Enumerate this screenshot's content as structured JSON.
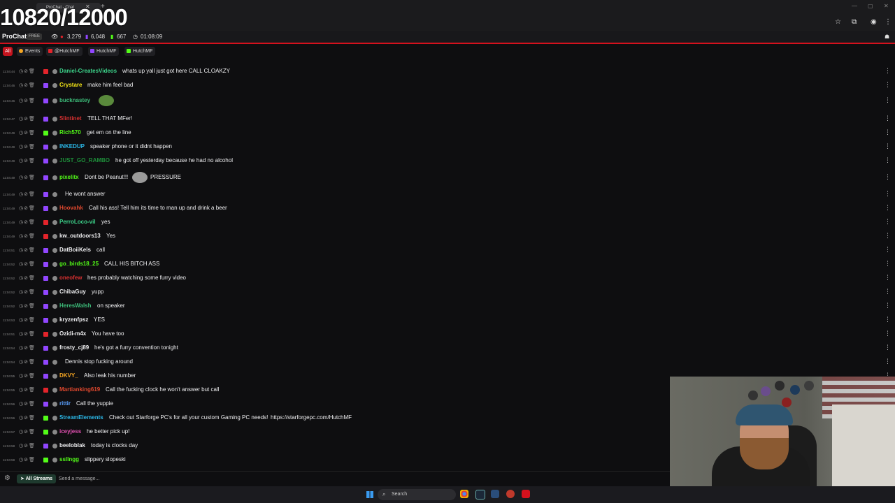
{
  "overlay": {
    "counter": "10820/12000"
  },
  "browser": {
    "tab_title": "ProChat - Chat"
  },
  "stats": {
    "brand": "ProChat",
    "plan": "FREE",
    "viewers": "3,279",
    "chatters": "6,048",
    "followers": "667",
    "uptime": "01:08:09"
  },
  "filters": [
    {
      "label": "All"
    },
    {
      "label": "Events"
    },
    {
      "label": "@HutchMF"
    },
    {
      "label": "HutchMF"
    },
    {
      "label": "HutchMF"
    }
  ],
  "colors": {
    "accent_red": "#d4111d",
    "youtube": "#e3242b",
    "twitch": "#9146ff",
    "kick": "#53fc18"
  },
  "messages": [
    {
      "time": "11:04:44",
      "platform": "youtube",
      "user": "Daniel-CreatesVideos",
      "color": "#3dd68c",
      "text": "whats up yall just got here CALL CLOAKZY"
    },
    {
      "time": "11:04:46",
      "platform": "twitch",
      "user": "Crystare",
      "color": "#f5e616",
      "text": "make him feel bad"
    },
    {
      "time": "11:04:46",
      "platform": "twitch",
      "user": "bucknastey",
      "color": "#3dbd7a",
      "text": ""
    },
    {
      "time": "11:04:47",
      "platform": "twitch",
      "user": "Slintinet",
      "color": "#d63030",
      "text": "TELL THAT MFer!"
    },
    {
      "time": "11:04:49",
      "platform": "kick",
      "user": "Rich570",
      "color": "#53fc18",
      "text": "get em on the line"
    },
    {
      "time": "11:04:49",
      "platform": "twitch",
      "user": "INKEDUP",
      "color": "#2bb8e8",
      "text": "speaker phone or it didnt happen"
    },
    {
      "time": "11:04:49",
      "platform": "twitch",
      "user": "JUST_GO_RAMBO",
      "color": "#1e8f3a",
      "text": "he got off yesterday because he had no alcohol"
    },
    {
      "time": "11:04:49",
      "platform": "twitch",
      "user": "pixelitx",
      "color": "#53fc18",
      "text": "Dont be Peanut!!!",
      "after": "PRESSURE"
    },
    {
      "time": "11:04:49",
      "platform": "twitch",
      "user": "",
      "color": "#1f3fcf",
      "text": "He wont answer"
    },
    {
      "time": "11:04:49",
      "platform": "twitch",
      "user": "Hoovahk",
      "color": "#e0482e",
      "text": "Call his ass! Tell him its time to man up and drink a beer"
    },
    {
      "time": "11:04:49",
      "platform": "youtube",
      "user": "PerroLoco-vil",
      "color": "#3dd68c",
      "text": "yes"
    },
    {
      "time": "11:04:49",
      "platform": "youtube",
      "user": "kw_outdoors13",
      "color": "#efeff1",
      "text": "Yes"
    },
    {
      "time": "11:04:51",
      "platform": "twitch",
      "user": "DatBoiiKels",
      "color": "#efeff1",
      "text": "call"
    },
    {
      "time": "11:04:52",
      "platform": "twitch",
      "user": "go_birds18_25",
      "color": "#53fc18",
      "text": "CALL HIS BITCH ASS"
    },
    {
      "time": "11:04:52",
      "platform": "twitch",
      "user": "oneofew",
      "color": "#d63030",
      "text": "hes probably watching some furry video"
    },
    {
      "time": "11:04:52",
      "platform": "twitch",
      "user": "ChibaGuy",
      "color": "#efeff1",
      "text": "yupp"
    },
    {
      "time": "11:04:52",
      "platform": "twitch",
      "user": "HeresWalsh",
      "color": "#3dbd7a",
      "text": "on speaker"
    },
    {
      "time": "11:04:53",
      "platform": "twitch",
      "user": "kryzenfpsz",
      "color": "#efeff1",
      "text": "YES"
    },
    {
      "time": "11:04:51",
      "platform": "youtube",
      "user": "Ozidi-m4x",
      "color": "#efeff1",
      "text": "You have too"
    },
    {
      "time": "11:04:54",
      "platform": "twitch",
      "user": "frosty_cj89",
      "color": "#efeff1",
      "text": "he's got a furry convention tonight"
    },
    {
      "time": "11:04:54",
      "platform": "twitch",
      "user": "",
      "color": "#1f3fcf",
      "text": "Dennis stop fucking around"
    },
    {
      "time": "11:04:55",
      "platform": "twitch",
      "user": "DKVY_",
      "color": "#f5a623",
      "text": "Also leak his number"
    },
    {
      "time": "11:04:55",
      "platform": "youtube",
      "user": "Martianking619",
      "color": "#e0482e",
      "text": "Call the fucking clock he won't answer but call"
    },
    {
      "time": "11:04:56",
      "platform": "twitch",
      "user": "rittir",
      "color": "#5aa0ff",
      "text": "Call the yuppie"
    },
    {
      "time": "11:04:56",
      "platform": "kick",
      "user": "StreamElements",
      "color": "#2bb8e8",
      "text": "Check out Starforge PC's for all your custom Gaming PC needs!",
      "link": "https://starforgepc.com/HutchMF"
    },
    {
      "time": "11:04:57",
      "platform": "kick",
      "user": "iceyjess",
      "color": "#e04fb0",
      "text": "he better pick up!"
    },
    {
      "time": "11:04:58",
      "platform": "twitch",
      "user": "beeloblak",
      "color": "#efeff1",
      "text": "today is clocks day"
    },
    {
      "time": "11:04:59",
      "platform": "kick",
      "user": "ssllngg",
      "color": "#53fc18",
      "text": "slippery slopeski"
    }
  ],
  "input": {
    "streams_label": "All Streams",
    "placeholder": "Send a message..."
  },
  "taskbar": {
    "search_label": "Search"
  }
}
